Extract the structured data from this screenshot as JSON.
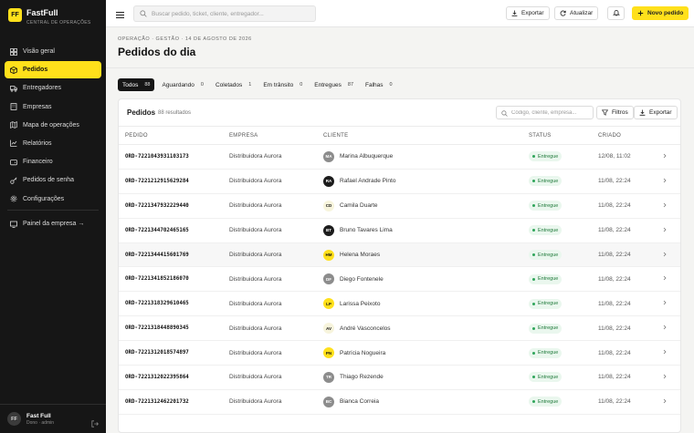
{
  "brand": {
    "logo_text": "FF",
    "name": "FastFull",
    "subtitle": "CENTRAL DE OPERAÇÕES"
  },
  "sidebar": {
    "items": [
      {
        "label": "Visão geral",
        "icon": "grid-icon",
        "active": false
      },
      {
        "label": "Pedidos",
        "icon": "box-icon",
        "active": true
      },
      {
        "label": "Entregadores",
        "icon": "truck-icon",
        "active": false
      },
      {
        "label": "Empresas",
        "icon": "building-icon",
        "active": false
      },
      {
        "label": "Mapa de operações",
        "icon": "map-icon",
        "active": false
      },
      {
        "label": "Relatórios",
        "icon": "chart-icon",
        "active": false
      },
      {
        "label": "Financeiro",
        "icon": "wallet-icon",
        "active": false
      },
      {
        "label": "Pedidos de senha",
        "icon": "key-icon",
        "active": false
      },
      {
        "label": "Configurações",
        "icon": "gear-icon",
        "active": false
      }
    ],
    "company_panel": "Painel da empresa →"
  },
  "user": {
    "initials": "FF",
    "name": "Fast Full",
    "role": "Dono · admin"
  },
  "topbar": {
    "search_placeholder": "Buscar pedido, ticket, cliente, entregador...",
    "export_label": "Exportar",
    "refresh_label": "Atualizar",
    "new_order_label": "Novo pedido"
  },
  "header": {
    "breadcrumb": "OPERAÇÃO · GESTÃO · 14 DE AGOSTO DE 2026",
    "title": "Pedidos do dia"
  },
  "tabs": [
    {
      "label": "Todos",
      "count": "88",
      "active": true
    },
    {
      "label": "Aguardando",
      "count": "0",
      "active": false
    },
    {
      "label": "Coletados",
      "count": "1",
      "active": false
    },
    {
      "label": "Em trânsito",
      "count": "0",
      "active": false
    },
    {
      "label": "Entregues",
      "count": "87",
      "active": false
    },
    {
      "label": "Falhas",
      "count": "0",
      "active": false
    }
  ],
  "card": {
    "title": "Pedidos",
    "count": "88 resultados",
    "search_placeholder": "Código, cliente, empresa...",
    "filters_label": "Filtros",
    "export_label": "Exportar"
  },
  "table": {
    "headers": [
      "PEDIDO",
      "EMPRESA",
      "CLIENTE",
      "STATUS",
      "CRIADO"
    ],
    "rows": [
      {
        "id": "ORD-7221043931103173",
        "company": "Distribuidora Aurora",
        "initials": "MA",
        "avatar": "gray",
        "client": "Marina Albuquerque",
        "status": "Entregue",
        "created": "12/08, 11:02"
      },
      {
        "id": "ORD-7221212915629284",
        "company": "Distribuidora Aurora",
        "initials": "RA",
        "avatar": "dark",
        "client": "Rafael Andrade Pinto",
        "status": "Entregue",
        "created": "11/08, 22:24"
      },
      {
        "id": "ORD-7221347932229440",
        "company": "Distribuidora Aurora",
        "initials": "CD",
        "avatar": "lt",
        "client": "Camila Duarte",
        "status": "Entregue",
        "created": "11/08, 22:24"
      },
      {
        "id": "ORD-7221344702465165",
        "company": "Distribuidora Aurora",
        "initials": "BT",
        "avatar": "dark",
        "client": "Bruno Tavares Lima",
        "status": "Entregue",
        "created": "11/08, 22:24"
      },
      {
        "id": "ORD-7221344415601769",
        "company": "Distribuidora Aurora",
        "initials": "HM",
        "avatar": "yel",
        "client": "Helena Moraes",
        "status": "Entregue",
        "created": "11/08, 22:24"
      },
      {
        "id": "ORD-7221341852186070",
        "company": "Distribuidora Aurora",
        "initials": "DF",
        "avatar": "gray",
        "client": "Diego Fontenele",
        "status": "Entregue",
        "created": "11/08, 22:24"
      },
      {
        "id": "ORD-7221318329610465",
        "company": "Distribuidora Aurora",
        "initials": "LP",
        "avatar": "yel",
        "client": "Larissa Peixoto",
        "status": "Entregue",
        "created": "11/08, 22:24"
      },
      {
        "id": "ORD-7221318448890345",
        "company": "Distribuidora Aurora",
        "initials": "AV",
        "avatar": "lt",
        "client": "André Vasconcelos",
        "status": "Entregue",
        "created": "11/08, 22:24"
      },
      {
        "id": "ORD-7221312018574897",
        "company": "Distribuidora Aurora",
        "initials": "PN",
        "avatar": "yel",
        "client": "Patrícia Nogueira",
        "status": "Entregue",
        "created": "11/08, 22:24"
      },
      {
        "id": "ORD-7221312022395864",
        "company": "Distribuidora Aurora",
        "initials": "TR",
        "avatar": "gray",
        "client": "Thiago Rezende",
        "status": "Entregue",
        "created": "11/08, 22:24"
      },
      {
        "id": "ORD-7221312462201732",
        "company": "Distribuidora Aurora",
        "initials": "BC",
        "avatar": "gray",
        "client": "Bianca Correia",
        "status": "Entregue",
        "created": "11/08, 22:24"
      }
    ]
  },
  "colors": {
    "accent": "#ffe01b",
    "sidebar_bg": "#161616",
    "success": "#2fa55a"
  }
}
